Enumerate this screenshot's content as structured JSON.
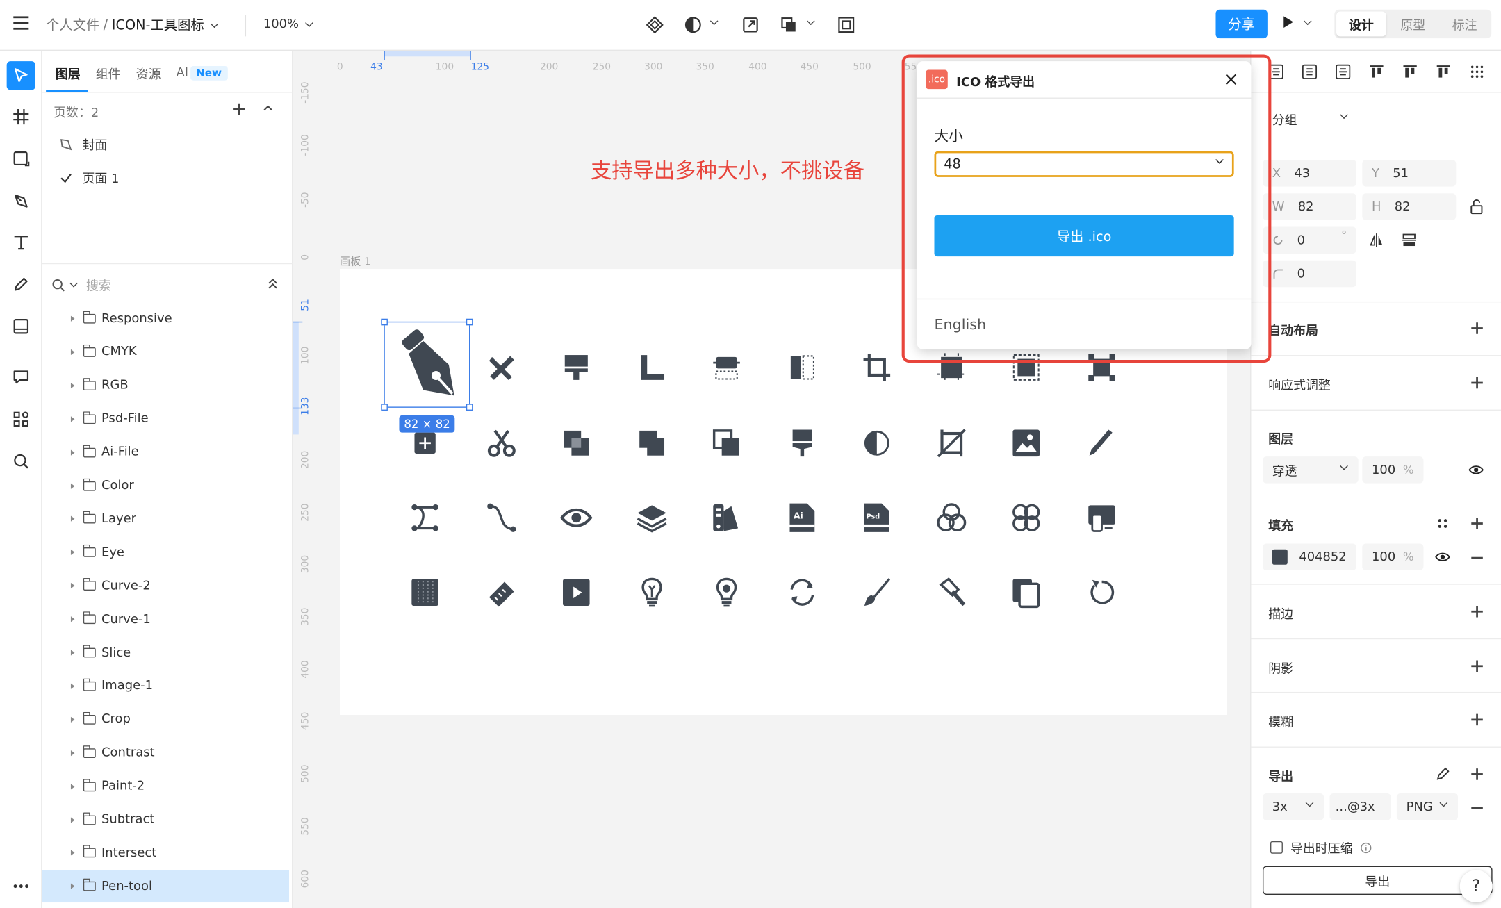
{
  "header": {
    "breadcrumb_root": "个人文件",
    "breadcrumb_sep": "/",
    "file_name": "ICON-工具图标",
    "zoom": "100%",
    "share_label": "分享",
    "modes": [
      "设计",
      "原型",
      "标注"
    ]
  },
  "left_panel": {
    "tabs": [
      "图层",
      "组件",
      "资源",
      "AI"
    ],
    "new_badge": "New",
    "page_count_label": "页数：2",
    "pages": [
      "封面",
      "页面 1"
    ],
    "search_placeholder": "搜索",
    "layers": [
      "Responsive",
      "CMYK",
      "RGB",
      "Psd-File",
      "Ai-File",
      "Color",
      "Layer",
      "Eye",
      "Curve-2",
      "Curve-1",
      "Slice",
      "Image-1",
      "Crop",
      "Contrast",
      "Paint-2",
      "Subtract",
      "Intersect",
      "Pen-tool"
    ],
    "selected_layer": "Pen-tool"
  },
  "canvas": {
    "h_ruler": [
      "0",
      "43",
      "100",
      "125",
      "200",
      "250",
      "300",
      "350",
      "400",
      "450",
      "500",
      "55"
    ],
    "v_ruler": [
      "-150",
      "-100",
      "-50",
      "0",
      "51",
      "100",
      "133",
      "200",
      "250",
      "300",
      "350",
      "400",
      "450",
      "500",
      "550",
      "600"
    ],
    "artboard_label": "画板 1",
    "annotation": "支持导出多种大小，不挑设备",
    "selection_size": "82 × 82"
  },
  "dialog": {
    "logo": ".ico",
    "title": "ICO 格式导出",
    "size_label": "大小",
    "size_value": "48",
    "export_label": "导出 .ico",
    "language": "English"
  },
  "right_panel": {
    "group_label": "分组",
    "x_label": "X",
    "x": "43",
    "y_label": "Y",
    "y": "51",
    "w_label": "W",
    "w": "82",
    "h_label": "H",
    "h": "82",
    "rotation": "0",
    "rotation_unit": "°",
    "radius": "0",
    "auto_layout": "自动布局",
    "responsive": "响应式调整",
    "layer_section": "图层",
    "blend_mode": "穿透",
    "layer_opacity": "100",
    "percent": "%",
    "fill_section": "填充",
    "fill_color": "#404852",
    "fill_hex": "404852",
    "fill_opacity": "100",
    "stroke_section": "描边",
    "shadow_section": "阴影",
    "blur_section": "模糊",
    "export_section": "导出",
    "export_scale": "3x",
    "export_suffix": "...@3x",
    "export_format": "PNG",
    "compress_label": "导出时压缩",
    "export_button": "导出",
    "help": "?"
  },
  "colors": {
    "accent": "#1890ff",
    "icon_dark": "#404852",
    "annotation_red": "#e8453c",
    "dialog_button": "#1da1f2",
    "select_border": "#e8a21a"
  }
}
